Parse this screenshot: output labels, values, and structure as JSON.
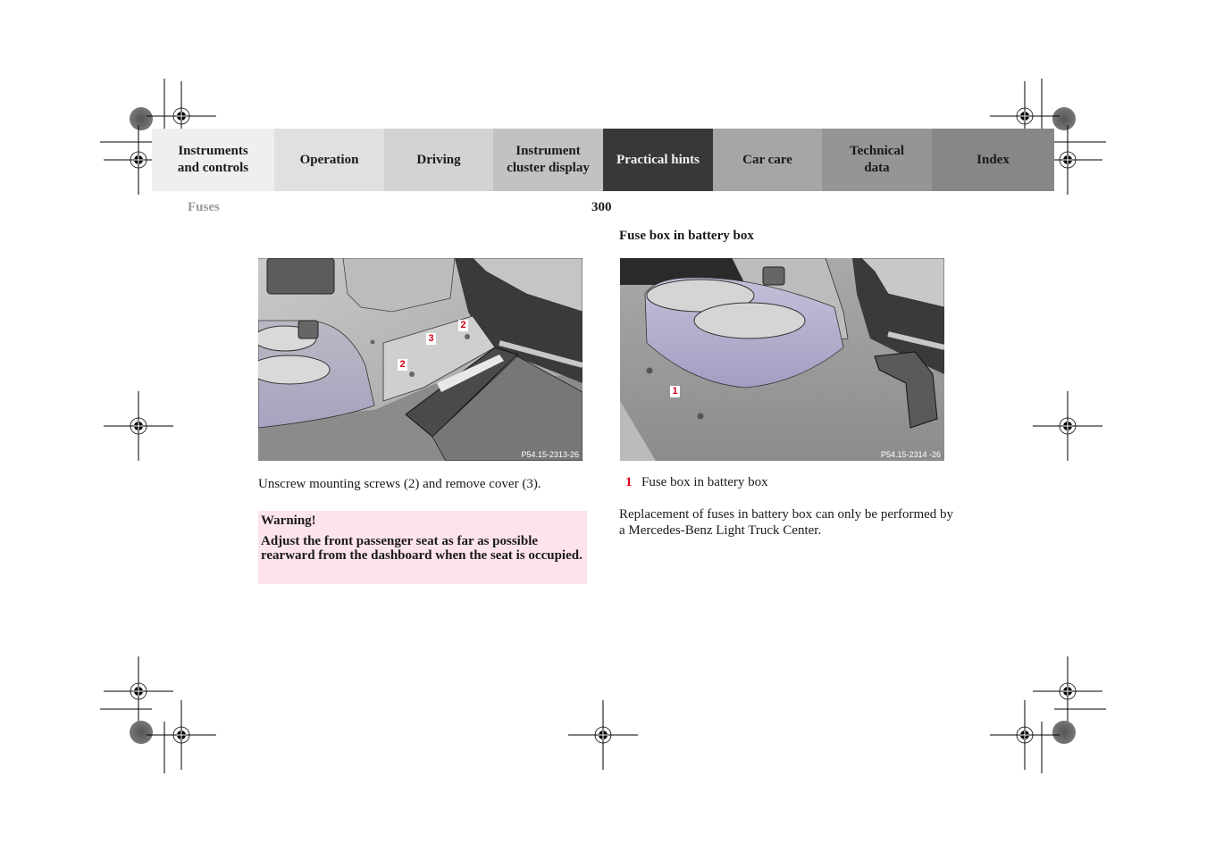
{
  "nav": {
    "tabs": [
      {
        "label": "Instruments\nand controls",
        "active": false
      },
      {
        "label": "Operation",
        "active": false
      },
      {
        "label": "Driving",
        "active": false
      },
      {
        "label": "Instrument\ncluster display",
        "active": false
      },
      {
        "label": "Practical hints",
        "active": true
      },
      {
        "label": "Car care",
        "active": false
      },
      {
        "label": "Technical\ndata",
        "active": false
      },
      {
        "label": "Index",
        "active": false
      }
    ]
  },
  "header": {
    "section": "Fuses",
    "page_number": "300"
  },
  "left": {
    "figure": {
      "code": "P54.15-2313-26",
      "callouts": [
        "2",
        "3",
        "2"
      ]
    },
    "instruction": "Unscrew mounting screws (2) and remove cover (3).",
    "warning": {
      "title": "Warning!",
      "body": "Adjust the front passenger seat as far as possible rearward from the dashboard when the seat is occupied."
    }
  },
  "right": {
    "heading": "Fuse box in battery box",
    "figure": {
      "code": "P54.15-2314 -26",
      "callouts": [
        "1"
      ]
    },
    "legend": [
      {
        "number": "1",
        "text": "Fuse box in battery box"
      }
    ],
    "paragraph": "Replacement of fuses in battery box can only be performed by a Mercedes-Benz Light Truck Center."
  },
  "colors": {
    "active_tab": "#383838",
    "warning_bg": "#fde4ec",
    "callout_red": "#d0021b"
  }
}
